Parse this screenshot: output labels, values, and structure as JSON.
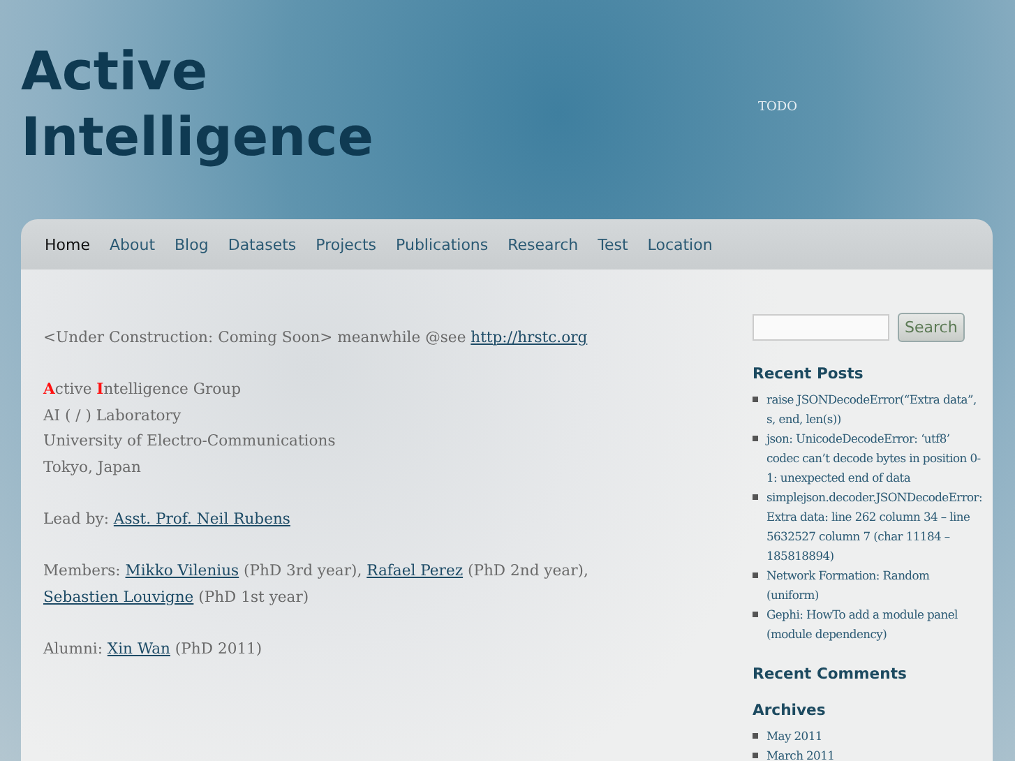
{
  "site": {
    "title": "Active Intelligence",
    "tagline": "TODO"
  },
  "nav": [
    {
      "label": "Home",
      "selected": true
    },
    {
      "label": "About",
      "selected": false
    },
    {
      "label": "Blog",
      "selected": false
    },
    {
      "label": "Datasets",
      "selected": false
    },
    {
      "label": "Projects",
      "selected": false
    },
    {
      "label": "Publications",
      "selected": false
    },
    {
      "label": "Research",
      "selected": false
    },
    {
      "label": "Test",
      "selected": false
    },
    {
      "label": "Location",
      "selected": false
    }
  ],
  "content": {
    "paragraphs": [
      [
        {
          "kind": "text",
          "text": "<Under Construction: Coming Soon>  meanwhile @see "
        },
        {
          "kind": "link",
          "text": "http://hrstc.org"
        }
      ],
      [
        {
          "kind": "accent",
          "text": "A"
        },
        {
          "kind": "text",
          "text": "ctive "
        },
        {
          "kind": "accent",
          "text": "I"
        },
        {
          "kind": "text",
          "text": "ntelligence Group"
        },
        {
          "kind": "break"
        },
        {
          "kind": "text",
          "text": "AI ( / ) Laboratory"
        },
        {
          "kind": "break"
        },
        {
          "kind": "text",
          "text": "University of Electro-Communications"
        },
        {
          "kind": "break"
        },
        {
          "kind": "text",
          "text": "Tokyo, Japan"
        }
      ],
      [
        {
          "kind": "text",
          "text": "Lead by: "
        },
        {
          "kind": "link",
          "text": "Asst. Prof. Neil Rubens"
        }
      ],
      [
        {
          "kind": "text",
          "text": "Members: "
        },
        {
          "kind": "link",
          "text": "Mikko Vilenius"
        },
        {
          "kind": "text",
          "text": " (PhD 3rd year), "
        },
        {
          "kind": "link",
          "text": "Rafael Perez"
        },
        {
          "kind": "text",
          "text": " (PhD 2nd year), "
        },
        {
          "kind": "link",
          "text": "Sebastien Louvigne"
        },
        {
          "kind": "text",
          "text": " (PhD 1st year)"
        }
      ],
      [
        {
          "kind": "text",
          "text": "Alumni:  "
        },
        {
          "kind": "link",
          "text": "Xin Wan"
        },
        {
          "kind": "text",
          "text": " (PhD 2011)"
        }
      ]
    ]
  },
  "sidebar": {
    "search_button": "Search",
    "widgets": [
      {
        "title": "Recent Posts",
        "items": [
          "raise JSONDecodeError(“Extra data”, s, end, len(s))",
          "json: UnicodeDecodeError: ‘utf8’ codec can’t decode bytes in position 0-1: unexpected end of data",
          "simplejson.decoder.JSONDecodeError: Extra data: line 262 column 34 – line 5632527 column 7 (char 11184 – 185818894)",
          "Network Formation: Random (uniform)",
          "Gephi: HowTo add a module panel (module dependency)"
        ]
      },
      {
        "title": "Recent Comments"
      },
      {
        "title": "Archives",
        "items": [
          "May 2011",
          "March 2011"
        ]
      }
    ]
  }
}
